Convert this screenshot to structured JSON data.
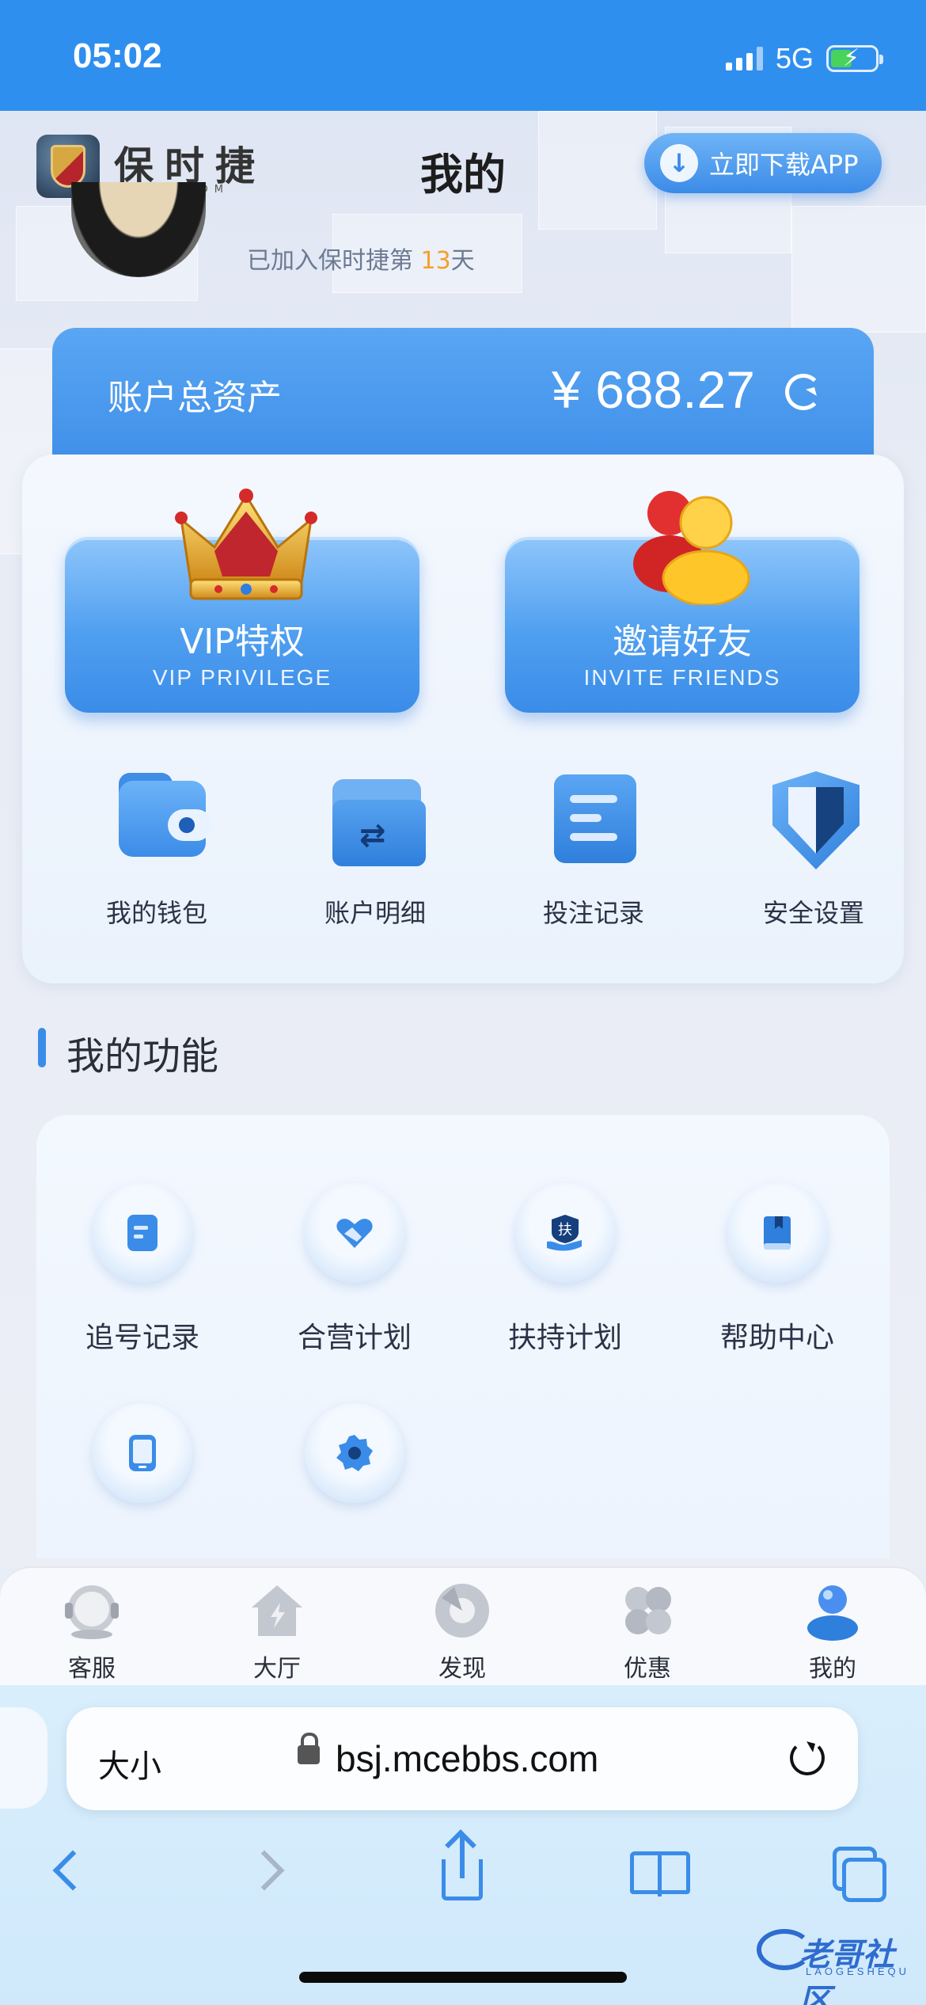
{
  "status_bar": {
    "time": "05:02",
    "network": "5G"
  },
  "header": {
    "brand_name": "保时捷",
    "brand_sub": "BSJ28.COM",
    "title": "我的",
    "download_label": "立即下载APP"
  },
  "user": {
    "joined_prefix": "已加入保时捷第 ",
    "joined_days": "13",
    "joined_suffix": "天"
  },
  "balance": {
    "label": "账户总资产",
    "value": "¥ 688.27"
  },
  "promos": [
    {
      "title": "VIP特权",
      "subtitle": "VIP PRIVILEGE"
    },
    {
      "title": "邀请好友",
      "subtitle": "INVITE FRIENDS"
    }
  ],
  "quick_actions": [
    {
      "label": "我的钱包",
      "icon": "wallet-icon"
    },
    {
      "label": "账户明细",
      "icon": "folder-transfer-icon"
    },
    {
      "label": "投注记录",
      "icon": "document-icon"
    },
    {
      "label": "安全设置",
      "icon": "shield-icon"
    }
  ],
  "features": {
    "title": "我的功能",
    "items": [
      {
        "label": "追号记录",
        "icon": "note-icon"
      },
      {
        "label": "合营计划",
        "icon": "handshake-icon"
      },
      {
        "label": "扶持计划",
        "icon": "support-hand-icon",
        "glyph": "扶"
      },
      {
        "label": "帮助中心",
        "icon": "help-book-icon"
      },
      {
        "label": "",
        "icon": "tablet-icon"
      },
      {
        "label": "",
        "icon": "settings-gear-icon"
      }
    ]
  },
  "tab_bar": [
    {
      "label": "客服",
      "icon": "customer-service-icon"
    },
    {
      "label": "大厅",
      "icon": "lobby-house-icon"
    },
    {
      "label": "发现",
      "icon": "discover-icon"
    },
    {
      "label": "优惠",
      "icon": "promotions-icon"
    },
    {
      "label": "我的",
      "icon": "profile-icon",
      "active": true
    }
  ],
  "browser": {
    "text_size_label": "大小",
    "url": "bsj.mcebbs.com"
  },
  "watermark": {
    "text": "老哥社区",
    "sub": "LAOGESHEQU"
  },
  "colors": {
    "accent": "#3a8ce8",
    "status_bar": "#2f8fee",
    "highlight": "#f5a02a"
  }
}
